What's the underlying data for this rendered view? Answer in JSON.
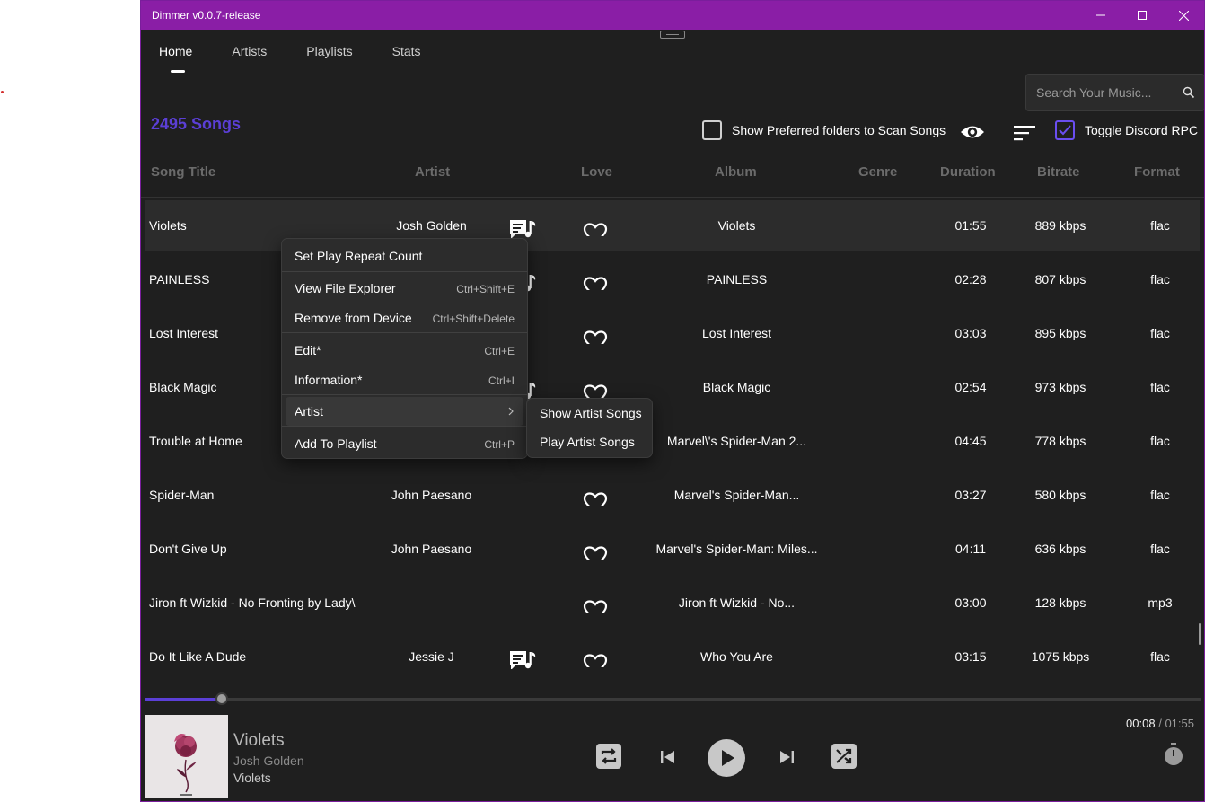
{
  "app": {
    "title": "Dimmer v0.0.7-release",
    "window_buttons": [
      "minimize-icon",
      "maximize-icon",
      "close-icon"
    ],
    "accent_color": "#8a1ea6",
    "highlight_color": "#5b3fd6"
  },
  "nav": {
    "tabs": [
      {
        "label": "Home",
        "active": true
      },
      {
        "label": "Artists",
        "active": false
      },
      {
        "label": "Playlists",
        "active": false
      },
      {
        "label": "Stats",
        "active": false
      }
    ]
  },
  "search": {
    "placeholder": "Search Your Music...",
    "value": "",
    "icon": "search-icon"
  },
  "library": {
    "song_count": "2495 Songs",
    "show_preferred_label": "Show Preferred folders to Scan Songs",
    "show_preferred_checked": false,
    "toggle_rpc_label": "Toggle Discord RPC",
    "toggle_rpc_checked": true
  },
  "table": {
    "columns": [
      "Song Title",
      "Artist",
      "Love",
      "Album",
      "Genre",
      "Duration",
      "Bitrate",
      "Format"
    ],
    "rows": [
      {
        "title": "Violets",
        "artist": "Josh Golden",
        "lyrics": true,
        "album": "Violets",
        "genre": "",
        "duration": "01:55",
        "bitrate": "889 kbps",
        "format": "flac",
        "selected": true
      },
      {
        "title": "PAINLESS",
        "artist": "",
        "lyrics": true,
        "album": "PAINLESS",
        "genre": "",
        "duration": "02:28",
        "bitrate": "807 kbps",
        "format": "flac"
      },
      {
        "title": "Lost Interest",
        "artist": "",
        "lyrics": false,
        "album": "Lost Interest",
        "genre": "",
        "duration": "03:03",
        "bitrate": "895 kbps",
        "format": "flac"
      },
      {
        "title": "Black Magic",
        "artist": "",
        "lyrics": true,
        "album": "Black Magic",
        "genre": "",
        "duration": "02:54",
        "bitrate": "973 kbps",
        "format": "flac"
      },
      {
        "title": "Trouble at Home",
        "artist": "",
        "lyrics": false,
        "album": "Marvel\\'s Spider-Man 2...",
        "genre": "",
        "duration": "04:45",
        "bitrate": "778 kbps",
        "format": "flac"
      },
      {
        "title": "Spider-Man",
        "artist": "John Paesano",
        "lyrics": false,
        "album": "Marvel's Spider-Man...",
        "genre": "",
        "duration": "03:27",
        "bitrate": "580 kbps",
        "format": "flac"
      },
      {
        "title": "Don't Give Up",
        "artist": "John Paesano",
        "lyrics": false,
        "album": "Marvel's Spider-Man: Miles...",
        "genre": "",
        "duration": "04:11",
        "bitrate": "636 kbps",
        "format": "flac"
      },
      {
        "title": "Jiron ft Wizkid - No Fronting by Lady\\",
        "artist": "",
        "lyrics": false,
        "album": "Jiron ft Wizkid - No...",
        "genre": "",
        "duration": "03:00",
        "bitrate": "128 kbps",
        "format": "mp3"
      },
      {
        "title": "Do It Like A Dude",
        "artist": "Jessie J",
        "lyrics": true,
        "album": "Who You Are",
        "genre": "",
        "duration": "03:15",
        "bitrate": "1075 kbps",
        "format": "flac"
      }
    ]
  },
  "context_menu": {
    "items": [
      {
        "label": "Set Play Repeat Count",
        "shortcut": ""
      },
      {
        "label": "View File Explorer",
        "shortcut": "Ctrl+Shift+E"
      },
      {
        "label": "Remove from Device",
        "shortcut": "Ctrl+Shift+Delete"
      },
      {
        "label": "Edit*",
        "shortcut": "Ctrl+E"
      },
      {
        "label": "Information*",
        "shortcut": "Ctrl+I"
      },
      {
        "label": "Artist",
        "shortcut": ""
      },
      {
        "label": "Add To Playlist",
        "shortcut": "Ctrl+P"
      }
    ],
    "submenu": [
      "Show Artist Songs",
      "Play Artist Songs"
    ]
  },
  "player": {
    "progress": 0.0727,
    "current_time": "00:08",
    "separator": "/",
    "total_time": "01:55",
    "title": "Violets",
    "artist": "Josh Golden",
    "album": "Violets",
    "controls": [
      "repeat-icon",
      "previous-icon",
      "play-icon",
      "next-icon",
      "shuffle-icon",
      "timer-icon"
    ]
  }
}
